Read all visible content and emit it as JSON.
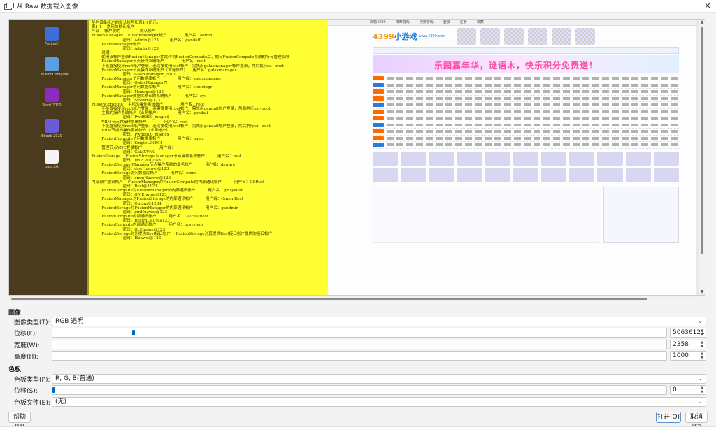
{
  "window": {
    "title": "从 Raw 数据载入图像",
    "close_glyph": "✕"
  },
  "preview": {
    "desktop_icons": [
      {
        "label": "FusionC",
        "color": "#3c6fd8"
      },
      {
        "label": "FusionCompute",
        "color": "#5aa0e0"
      },
      {
        "label": "Word 2010",
        "color": "#8b2cc0"
      },
      {
        "label": "Ebook 2020",
        "color": "#6a5bd8"
      },
      {
        "label": "pass.txt",
        "color": "#f4f4f4"
      }
    ],
    "notepad_lines": [
      "华为设备帐户的默认帐号如表1-1所示。",
      "表1-1    常用的默认帐户",
      "产品    帐户说明                默认帐户",
      "FusionManager    FusionManager帐户              用户名：admin",
      "                         密码：Admin@123         用户名：gandalf",
      "        FusionManager帐户",
      "                         密码：Admin@123",
      "        说明：",
      "        使用该帐户登录FusionManager并跳转到FusionCompute后，拥有FusionCompute系统的所有管理权限",
      "        FusionManager节点操作系统帐户              用户名：root",
      "        不能直接使用root帐户登录，若需要使用root帐户，需先用galaxmanager帐户登录，然后执行su - root",
      "        FusionManager节点操作系统帐户（业务帐户）    用户名：galaxmanager",
      "                         密码：GalaxManager_2012",
      "        FusionManager访问数据库帐户              用户名：galaxmanager",
      "                         密码：GalaxManager7!",
      "        FusionManager访问数据库帐户              用户名：cloudmgr",
      "                         密码：Manager@123",
      "        FusionManager数据库默认的系统帐户          用户名：sys",
      "                         密码：System@123",
      "FusionCompute    主机的操作系统帐户              用户名：root",
      "        不能直接使用root帐户登录，若需要使用root帐户，需先用gandalf帐户登录，然后执行su - root",
      "        主机的操作系统帐户（业务帐户）              用户名：gandalf",
      "                         密码：Pwd8800_magic$",
      "        VRM节点的操作系统帐户              用户名：root",
      "        不能直接使用root帐户登录，若需要使用root帐户，需先用gandalf帐户登录，然后执行su - root",
      "        VRM节点的操作系统帐户（业务帐户）",
      "                         密码：Pwd8800_magic$",
      "        FusionCompute访问数据库帐户              用户名：galax",
      "                         密码：SingleLINE01",
      "        管理节点VNC登录帐户              用户名：",
      "                         密码：GalaXVNC",
      "FusionStorage    FusionStorage Manager节点操作系统帐户          用户名：root",
      "                         密码：IMP_2012lab",
      "        FusionStorage Manager节点操作系统的业务帐户          用户名：dsware",
      "                         密码：dswHuawei@123",
      "        FusionStorage访问数据库帐户          用户名：omm",
      "                         密码：ommHuawei@123",
      "内部部件通讯帐户    FusionManager对FusionCompute的内部通讯帐户          用户名：GSRest",
      "                         密码：Rest@1123",
      "        FusionCompute对FusionManager的内部通讯帐户          用户名：gmsystem",
      "                         密码：GMEngine@123",
      "        FusionManager对FusionStorage的内部通讯帐户          用户名：OummRest",
      "                         密码：Oumm@1234",
      "        FusionStorage对FusionManager的内部通讯帐户          用户名：gandmin",
      "                         密码：gmHuawei@123",
      "        FusionCompute内部通讯帐户          用户名：GalHuaRest",
      "                         密码：RestMGalHua123",
      "        FusionCompute内部通讯帐户          用户名：gcsystem",
      "                         密码：GcEngine@123",
      "        FusionStorage对外提供Rest接口帐户    FusionStorage对其提供Rest接口帐户提供的接口帐户",
      "                         密码：Huawei@123"
    ],
    "web": {
      "toplinks": [
        "邮箱4399",
        "推荐游戏",
        "搜索游戏",
        "登录",
        "注册",
        "收藏"
      ],
      "logo_num": "4399",
      "logo_text": "小游戏",
      "logo_sub": "www.4399.com",
      "hero_text": "乐园嘉年华，谜语木，快乐积分免费送！"
    }
  },
  "image_section": {
    "heading": "图像",
    "type_label": "图像类型(T):",
    "type_value": "RGB 透明",
    "offset_label": "位移(F):",
    "offset_value": "50636121",
    "offset_fraction": 0.13,
    "width_label": "宽度(W):",
    "width_value": "2358",
    "height_label": "高度(H):",
    "height_value": "1000"
  },
  "palette_section": {
    "heading": "色板",
    "type_label": "色板类型(P):",
    "type_value": "R, G, B(普通)",
    "offset_label": "位移(S):",
    "offset_value": "0",
    "offset_fraction": 0.0,
    "file_label": "色板文件(E):",
    "file_value": "(无)"
  },
  "buttons": {
    "help": "帮助(H)",
    "open": "打开(O)",
    "cancel": "取消(C)"
  }
}
